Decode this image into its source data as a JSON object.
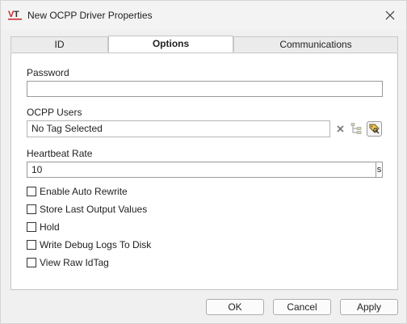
{
  "window": {
    "title": "New OCPP Driver Properties",
    "logo_text": "VT",
    "logo_colors": {
      "v": "#cc2222",
      "t": "#333333"
    }
  },
  "tabs": [
    {
      "label": "ID",
      "active": false
    },
    {
      "label": "Options",
      "active": true
    },
    {
      "label": "Communications",
      "active": false
    }
  ],
  "options": {
    "password": {
      "label": "Password",
      "value": "",
      "placeholder": ""
    },
    "ocpp_users": {
      "label": "OCPP Users",
      "value": "No Tag Selected",
      "buttons": [
        "clear-icon",
        "tag-tree-icon",
        "tag-browse-icon"
      ]
    },
    "heartbeat": {
      "label": "Heartbeat Rate",
      "value": "10",
      "unit": "s"
    },
    "checkboxes": [
      {
        "label": "Enable Auto Rewrite",
        "checked": false
      },
      {
        "label": "Store Last Output Values",
        "checked": false
      },
      {
        "label": "Hold",
        "checked": false
      },
      {
        "label": "Write Debug Logs To Disk",
        "checked": false
      },
      {
        "label": "View Raw IdTag",
        "checked": false
      }
    ]
  },
  "footer": {
    "ok": "OK",
    "cancel": "Cancel",
    "apply": "Apply"
  }
}
